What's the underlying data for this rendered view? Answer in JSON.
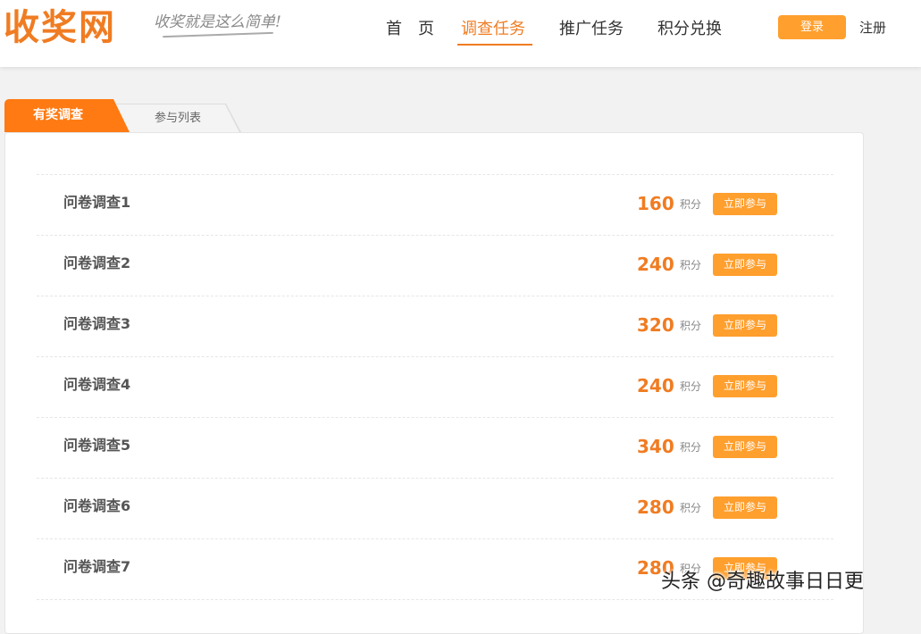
{
  "header": {
    "logo": "收奖网",
    "slogan": "收奖就是这么简单!",
    "nav": [
      {
        "label": "首　页",
        "active": false
      },
      {
        "label": "调查任务",
        "active": true
      },
      {
        "label": "推广任务",
        "active": false
      },
      {
        "label": "积分兑换",
        "active": false
      }
    ],
    "login_label": "登录",
    "register_label": "注册"
  },
  "tabs": {
    "active_label": "有奖调查",
    "inactive_label": "参与列表"
  },
  "surveys": [
    {
      "title": "问卷调查1",
      "points": "160",
      "unit": "积分",
      "action": "立即参与"
    },
    {
      "title": "问卷调查2",
      "points": "240",
      "unit": "积分",
      "action": "立即参与"
    },
    {
      "title": "问卷调查3",
      "points": "320",
      "unit": "积分",
      "action": "立即参与"
    },
    {
      "title": "问卷调查4",
      "points": "240",
      "unit": "积分",
      "action": "立即参与"
    },
    {
      "title": "问卷调查5",
      "points": "340",
      "unit": "积分",
      "action": "立即参与"
    },
    {
      "title": "问卷调查6",
      "points": "280",
      "unit": "积分",
      "action": "立即参与"
    },
    {
      "title": "问卷调查7",
      "points": "280",
      "unit": "积分",
      "action": "立即参与"
    }
  ],
  "watermark": "头条 @奇趣故事日日更",
  "colors": {
    "accent": "#f07c22",
    "button": "#ff9f2e",
    "tab_active": "#ff7a12"
  }
}
